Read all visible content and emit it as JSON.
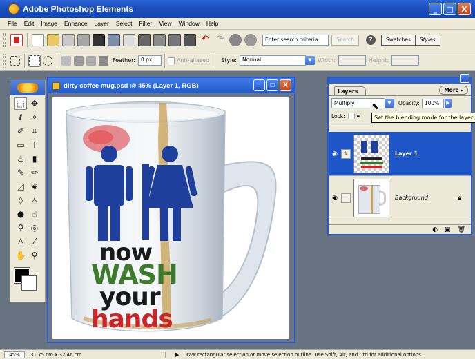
{
  "app": {
    "title": "Adobe Photoshop Elements",
    "window_buttons": [
      "_",
      "□",
      "X"
    ]
  },
  "menu": [
    "File",
    "Edit",
    "Image",
    "Enhance",
    "Layer",
    "Select",
    "Filter",
    "View",
    "Window",
    "Help"
  ],
  "shortcuts_bar": {
    "search_placeholder": "Enter search criteria",
    "search_button": "Search",
    "palette_tabs": [
      "Swatches",
      "Styles"
    ]
  },
  "options_bar": {
    "feather_label": "Feather:",
    "feather_value": "0 px",
    "antialiased_label": "Anti-aliased",
    "style_label": "Style:",
    "style_value": "Normal",
    "width_label": "Width:",
    "height_label": "Height:"
  },
  "document": {
    "title": "dirty coffee mug.psd @ 45% (Layer 1, RGB)",
    "mug_text": [
      "now",
      "WASH",
      "your",
      "hands"
    ]
  },
  "layers_palette": {
    "tab": "Layers",
    "more_button": "More ▸",
    "blend_mode": "Multiply",
    "opacity_label": "Opacity:",
    "opacity_value": "100%",
    "lock_label": "Lock:",
    "tooltip": "Set the blending mode for the layer",
    "layers": [
      {
        "name": "Layer 1",
        "selected": true
      },
      {
        "name": "Background",
        "selected": false
      }
    ]
  },
  "statusbar": {
    "zoom": "45%",
    "dimensions": "31.75 cm x 32.46 cm",
    "hint": "Draw rectangular selection or move selection outline. Use Shift, Alt, and Ctrl for additional options."
  },
  "colors": {
    "title_blue": "#1b4fbf",
    "chrome": "#ece9d8",
    "workspace": "#687382",
    "selected_layer": "#1e56c8",
    "mug_red": "#c8262a",
    "mug_green": "#3e7a2c",
    "figure_blue": "#1f3f9c"
  }
}
